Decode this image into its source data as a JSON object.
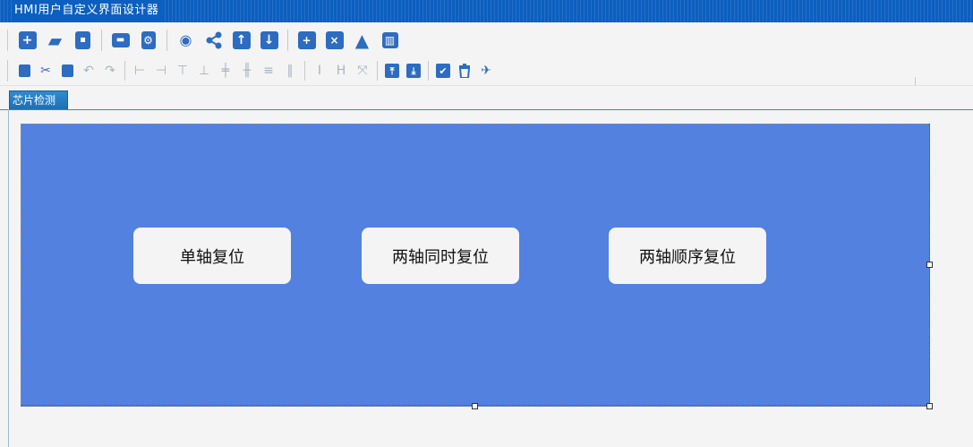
{
  "window": {
    "title": "HMI用户自定义界面设计器"
  },
  "toolbar1": {
    "items": [
      {
        "icon": "new-icon",
        "glyph": "+"
      },
      {
        "icon": "open-folder-icon",
        "glyph": "▰"
      },
      {
        "icon": "save-icon",
        "glyph": "▪"
      },
      {
        "icon": "toolbox-icon",
        "glyph": "▬"
      },
      {
        "icon": "device-settings-icon",
        "glyph": "⚙"
      },
      {
        "icon": "preview-eye-icon",
        "glyph": "◉"
      },
      {
        "icon": "share-icon",
        "glyph": "⊲"
      },
      {
        "icon": "upload-icon",
        "glyph": "↑"
      },
      {
        "icon": "download-icon",
        "glyph": "↓"
      },
      {
        "icon": "window-add-icon",
        "glyph": "+"
      },
      {
        "icon": "window-close-icon",
        "glyph": "×"
      },
      {
        "icon": "warning-icon",
        "glyph": "▲"
      },
      {
        "icon": "layout-icon",
        "glyph": "▥"
      }
    ]
  },
  "toolbar2": {
    "items": [
      {
        "icon": "copy-icon",
        "glyph": "❐"
      },
      {
        "icon": "cut-icon",
        "glyph": "✂"
      },
      {
        "icon": "paste-icon",
        "glyph": "❏"
      },
      {
        "icon": "undo-icon",
        "glyph": "↶"
      },
      {
        "icon": "redo-icon",
        "glyph": "↷"
      },
      {
        "icon": "align-left-icon",
        "glyph": "⊢"
      },
      {
        "icon": "align-right-icon",
        "glyph": "⊣"
      },
      {
        "icon": "align-top-icon",
        "glyph": "⊤"
      },
      {
        "icon": "align-bottom-icon",
        "glyph": "⊥"
      },
      {
        "icon": "align-center-vertical-icon",
        "glyph": "╪"
      },
      {
        "icon": "align-center-horizontal-icon",
        "glyph": "╫"
      },
      {
        "icon": "distribute-vertical-icon",
        "glyph": "≡"
      },
      {
        "icon": "distribute-horizontal-icon",
        "glyph": "‖"
      },
      {
        "icon": "same-height-icon",
        "glyph": "I"
      },
      {
        "icon": "same-width-icon",
        "glyph": "H"
      },
      {
        "icon": "same-size-icon",
        "glyph": "⤧"
      },
      {
        "icon": "bring-to-front-icon",
        "glyph": "⤒"
      },
      {
        "icon": "send-to-back-icon",
        "glyph": "⤓"
      },
      {
        "icon": "select-all-icon",
        "glyph": "✔"
      },
      {
        "icon": "delete-icon",
        "glyph": "🗑"
      },
      {
        "icon": "clear-icon",
        "glyph": "✈"
      }
    ]
  },
  "tabs": [
    {
      "label": "芯片检测"
    }
  ],
  "canvas": {
    "panel_color": "#5281e0",
    "buttons": [
      {
        "label": "单轴复位"
      },
      {
        "label": "两轴同时复位"
      },
      {
        "label": "两轴顺序复位"
      }
    ]
  },
  "colors": {
    "title_bar": "#0c5fbf",
    "icon": "#2d6cc0",
    "icon_disabled": "#a9b3c0",
    "tab": "#2f8bd0"
  }
}
